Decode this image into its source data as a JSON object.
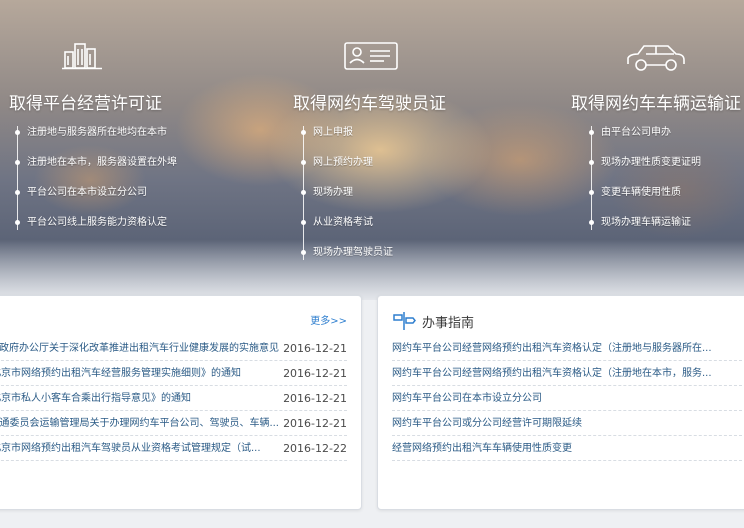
{
  "columns": [
    {
      "title": "取得平台经营许可证",
      "icon": "buildings-icon",
      "items": [
        "注册地与服务器所在地均在本市",
        "注册地在本市，服务器设置在外埠",
        "平台公司在本市设立分公司",
        "平台公司线上服务能力资格认定"
      ]
    },
    {
      "title": "取得网约车驾驶员证",
      "icon": "id-card-icon",
      "items": [
        "网上申报",
        "网上预约办理",
        "现场办理",
        "从业资格考试",
        "现场办理驾驶员证"
      ]
    },
    {
      "title": "取得网约车车辆运输证",
      "icon": "car-icon",
      "items": [
        "由平台公司申办",
        "现场办理性质变更证明",
        "变更车辆使用性质",
        "现场办理车辆运输证"
      ]
    }
  ],
  "news": {
    "more_label": "更多>>",
    "items": [
      {
        "title": "京市人民政府办公厅关于深化改革推进出租汽车行业健康发展的实施意见",
        "date": "2016-12-21"
      },
      {
        "title": "北京市网络预约出租汽车经营服务管理实施细则》的通知",
        "date": "2016-12-21"
      },
      {
        "title": "北京市私人小客车合乘出行指导意见》的通知",
        "date": "2016-12-21"
      },
      {
        "title": "京市交通委员会运输管理局关于办理网约车平台公司、驾驶员、车辆...",
        "date": "2016-12-21"
      },
      {
        "title": "北京市网络预约出租汽车驾驶员从业资格考试管理规定（试...",
        "date": "2016-12-22"
      }
    ]
  },
  "guide": {
    "title": "办事指南",
    "icon": "signpost-icon",
    "items": [
      "网约车平台公司经营网络预约出租汽车资格认定（注册地与服务器所在...",
      "网约车平台公司经营网络预约出租汽车资格认定（注册地在本市，服务...",
      "网约车平台公司在本市设立分公司",
      "网约车平台公司或分公司经营许可期限延续",
      "经营网络预约出租汽车车辆使用性质变更"
    ]
  }
}
